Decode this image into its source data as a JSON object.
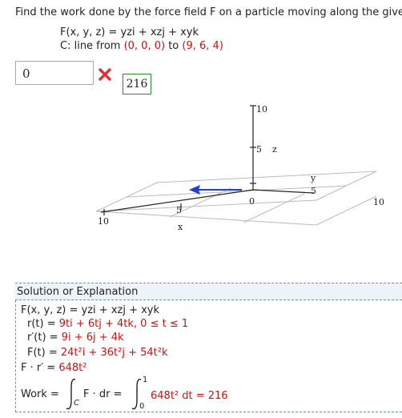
{
  "question": {
    "text": "Find the work done by the force field F on a particle moving along the give",
    "field_prefix": "F(x, y, z) = ",
    "field_expr": "yzi + xzj + xyk",
    "curve_prefix": "C: line from ",
    "curve_from": "(0, 0, 0)",
    "curve_to_word": " to ",
    "curve_to": "(9, 6, 4)"
  },
  "answer": {
    "entered_value": "0",
    "status": "incorrect",
    "correct_value": "216",
    "colors": {
      "incorrect": "#e03030",
      "correct_border": "#2e8b2e"
    }
  },
  "graph": {
    "z_ticks": [
      "10",
      "5",
      "z"
    ],
    "y_labels": [
      "y",
      "5",
      "10"
    ],
    "x_labels": [
      "10",
      "5",
      "x"
    ],
    "origin": "0",
    "colors": {
      "arrow": "#1f3fd6",
      "axis": "#222222",
      "grid": "#bbbbbb"
    }
  },
  "solution": {
    "title": "Solution or Explanation",
    "lines": [
      {
        "lhs": "F(x, y, z) = ",
        "rhs": "yzi + xzj + xyk"
      },
      {
        "lhs": "r(t) = ",
        "rhs": "9ti + 6tj + 4tk,   0 ≤ t ≤ 1"
      },
      {
        "lhs": "r′(t) = ",
        "rhs": "9i + 6j + 4k"
      },
      {
        "lhs": "F(t) = ",
        "rhs": "24t²i + 36t²j + 54t²k"
      },
      {
        "lhs": "F · r′ = ",
        "rhs": "648t²"
      }
    ],
    "work_label": "Work = ",
    "integral_sub": "C",
    "integrand": "F · dr = ",
    "int_upper": "1",
    "int_lower": "0",
    "integrand2": "648t² dt = ",
    "result": "216"
  }
}
